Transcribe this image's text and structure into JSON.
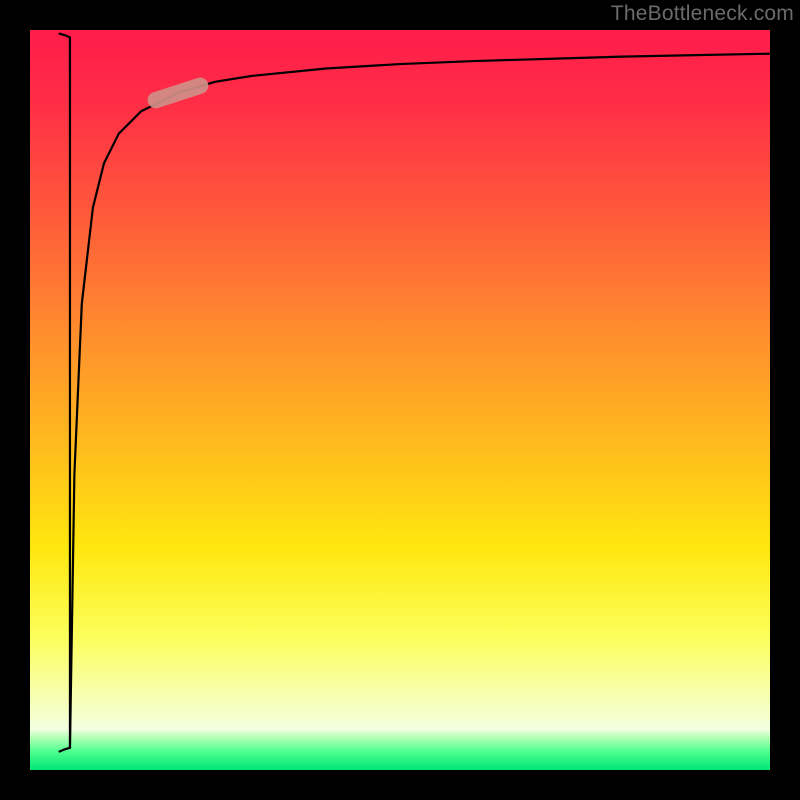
{
  "watermark": {
    "text": "TheBottleneck.com"
  },
  "chart_data": {
    "type": "line",
    "title": "",
    "xlabel": "",
    "ylabel": "",
    "xlim": [
      0,
      100
    ],
    "ylim": [
      0,
      100
    ],
    "grid": false,
    "series": [
      {
        "name": "notch",
        "x": [
          4.0,
          4.7,
          5.4,
          5.4,
          4.7,
          4.0
        ],
        "y": [
          99.5,
          99.3,
          99.0,
          3.0,
          2.8,
          2.5
        ],
        "color": "#000000",
        "thickness": 2.2
      },
      {
        "name": "curve",
        "x": [
          5.4,
          6.0,
          7.0,
          8.5,
          10.0,
          12.0,
          15.0,
          20.0,
          25.0,
          30.0,
          40.0,
          50.0,
          60.0,
          70.0,
          80.0,
          90.0,
          100.0
        ],
        "y": [
          3.0,
          40.0,
          63.0,
          76.0,
          82.0,
          86.0,
          89.0,
          91.5,
          93.0,
          93.8,
          94.8,
          95.4,
          95.8,
          96.1,
          96.4,
          96.6,
          96.8
        ],
        "color": "#000000",
        "thickness": 2.2
      }
    ],
    "markers": [
      {
        "name": "highlight-pill",
        "cx": 20.0,
        "cy": 91.5,
        "angle_deg": -18,
        "width": 8.5,
        "height": 2.2,
        "fill": "#d08f88",
        "opacity": 0.92
      }
    ],
    "background_gradient": {
      "stops": [
        {
          "offset": 0.0,
          "color": "#ff1c4a"
        },
        {
          "offset": 0.1,
          "color": "#ff2e46"
        },
        {
          "offset": 0.25,
          "color": "#ff5a3a"
        },
        {
          "offset": 0.4,
          "color": "#ff8a2e"
        },
        {
          "offset": 0.55,
          "color": "#ffb81e"
        },
        {
          "offset": 0.7,
          "color": "#ffe70e"
        },
        {
          "offset": 0.82,
          "color": "#fbff5a"
        },
        {
          "offset": 0.9,
          "color": "#f7ffb0"
        },
        {
          "offset": 0.945,
          "color": "#f2ffe0"
        },
        {
          "offset": 0.955,
          "color": "#b8ffb8"
        },
        {
          "offset": 0.975,
          "color": "#4eff8e"
        },
        {
          "offset": 1.0,
          "color": "#00e676"
        }
      ]
    }
  }
}
